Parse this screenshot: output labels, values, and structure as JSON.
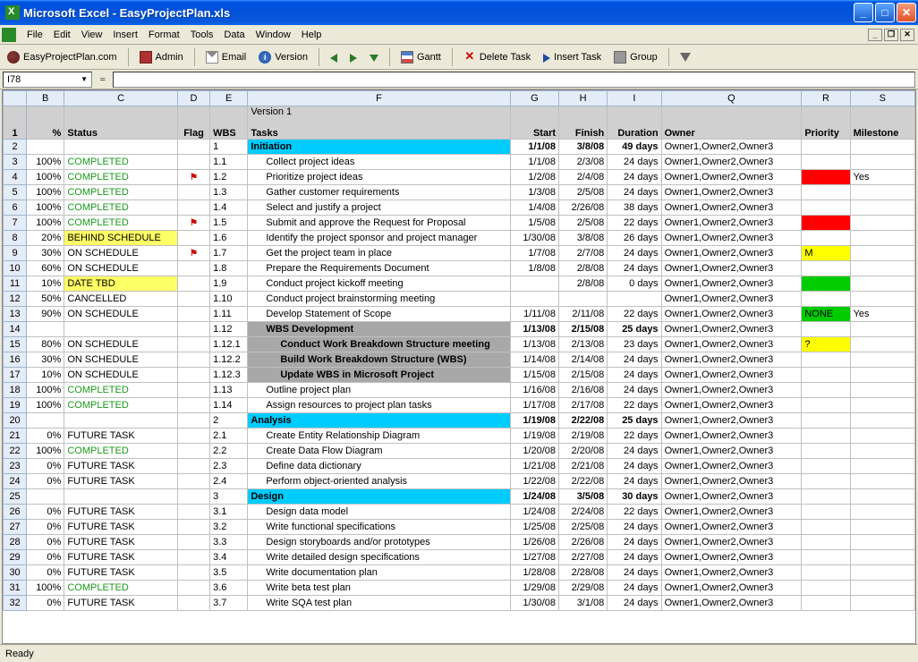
{
  "window": {
    "title": "Microsoft Excel - EasyProjectPlan.xls"
  },
  "menu": [
    "File",
    "Edit",
    "View",
    "Insert",
    "Format",
    "Tools",
    "Data",
    "Window",
    "Help"
  ],
  "toolbar": {
    "site": "EasyProjectPlan.com",
    "admin": "Admin",
    "email": "Email",
    "version": "Version",
    "gantt": "Gantt",
    "delete": "Delete Task",
    "insert": "Insert Task",
    "group": "Group"
  },
  "namebox": "I78",
  "formula": "=",
  "version_label": "Version 1",
  "columns": [
    "B",
    "C",
    "D",
    "E",
    "F",
    "G",
    "H",
    "I",
    "Q",
    "R",
    "S"
  ],
  "headers": {
    "B": "%",
    "C": "Status",
    "D": "Flag",
    "E": "WBS",
    "F": "Tasks",
    "G": "Start",
    "H": "Finish",
    "I": "Duration",
    "Q": "Owner",
    "R": "Priority",
    "S": "Milestone"
  },
  "rows": [
    {
      "r": 2,
      "pct": "",
      "status": "",
      "flag": "",
      "wbs": "1",
      "task": "Initiation",
      "taskbg": "cyan",
      "start": "1/1/08",
      "finish": "3/8/08",
      "dur": "49 days",
      "owner": "Owner1,Owner2,Owner3",
      "pr": "",
      "ms": "",
      "bold": true
    },
    {
      "r": 3,
      "pct": "100%",
      "status": "COMPLETED",
      "stc": "completed",
      "wbs": "1.1",
      "task": "Collect project ideas",
      "ind": 1,
      "start": "1/1/08",
      "finish": "2/3/08",
      "dur": "24 days",
      "owner": "Owner1,Owner2,Owner3"
    },
    {
      "r": 4,
      "pct": "100%",
      "status": "COMPLETED",
      "stc": "completed",
      "flag": "⚑",
      "wbs": "1.2",
      "task": "Prioritize project ideas",
      "ind": 1,
      "start": "1/2/08",
      "finish": "2/4/08",
      "dur": "24 days",
      "owner": "Owner1,Owner2,Owner3",
      "pr": "",
      "prc": "red",
      "ms": "Yes"
    },
    {
      "r": 5,
      "pct": "100%",
      "status": "COMPLETED",
      "stc": "completed",
      "wbs": "1.3",
      "task": "Gather customer requirements",
      "ind": 1,
      "start": "1/3/08",
      "finish": "2/5/08",
      "dur": "24 days",
      "owner": "Owner1,Owner2,Owner3"
    },
    {
      "r": 6,
      "pct": "100%",
      "status": "COMPLETED",
      "stc": "completed",
      "wbs": "1.4",
      "task": "Select and justify a project",
      "ind": 1,
      "start": "1/4/08",
      "finish": "2/26/08",
      "dur": "38 days",
      "owner": "Owner1,Owner2,Owner3"
    },
    {
      "r": 7,
      "pct": "100%",
      "status": "COMPLETED",
      "stc": "completed",
      "flag": "⚑",
      "wbs": "1.5",
      "task": "Submit and approve the Request for Proposal",
      "ind": 1,
      "start": "1/5/08",
      "finish": "2/5/08",
      "dur": "22 days",
      "owner": "Owner1,Owner2,Owner3",
      "pr": "",
      "prc": "red"
    },
    {
      "r": 8,
      "pct": "20%",
      "status": "BEHIND SCHEDULE",
      "stc": "behind",
      "wbs": "1.6",
      "task": "Identify the project sponsor and project manager",
      "ind": 1,
      "start": "1/30/08",
      "finish": "3/8/08",
      "dur": "26 days",
      "owner": "Owner1,Owner2,Owner3"
    },
    {
      "r": 9,
      "pct": "30%",
      "status": "ON SCHEDULE",
      "flag": "⚑",
      "wbs": "1.7",
      "task": "Get the project team in place",
      "ind": 1,
      "start": "1/7/08",
      "finish": "2/7/08",
      "dur": "24 days",
      "owner": "Owner1,Owner2,Owner3",
      "pr": "M",
      "prc": "yellow"
    },
    {
      "r": 10,
      "pct": "60%",
      "status": "ON SCHEDULE",
      "wbs": "1.8",
      "task": "Prepare the Requirements Document",
      "ind": 1,
      "start": "1/8/08",
      "finish": "2/8/08",
      "dur": "24 days",
      "owner": "Owner1,Owner2,Owner3"
    },
    {
      "r": 11,
      "pct": "10%",
      "status": "DATE TBD",
      "stc": "tbd",
      "wbs": "1.9",
      "task": "Conduct project kickoff meeting",
      "ind": 1,
      "start": "",
      "finish": "2/8/08",
      "dur": "0 days",
      "owner": "Owner1,Owner2,Owner3",
      "pr": "",
      "prc": "green"
    },
    {
      "r": 12,
      "pct": "50%",
      "status": "CANCELLED",
      "wbs": "1.10",
      "task": "Conduct project brainstorming meeting",
      "ind": 1,
      "start": "",
      "finish": "",
      "dur": "",
      "owner": "Owner1,Owner2,Owner3"
    },
    {
      "r": 13,
      "pct": "90%",
      "status": "ON SCHEDULE",
      "wbs": "1.11",
      "task": "Develop Statement of Scope",
      "ind": 1,
      "start": "1/11/08",
      "finish": "2/11/08",
      "dur": "22 days",
      "owner": "Owner1,Owner2,Owner3",
      "pr": "NONE",
      "prc": "green",
      "ms": "Yes"
    },
    {
      "r": 14,
      "pct": "",
      "status": "",
      "wbs": "1.12",
      "task": "WBS Development",
      "taskbg": "gray",
      "ind": 1,
      "start": "1/13/08",
      "finish": "2/15/08",
      "dur": "25 days",
      "owner": "Owner1,Owner2,Owner3",
      "bold": true
    },
    {
      "r": 15,
      "pct": "80%",
      "status": "ON SCHEDULE",
      "wbs": "1.12.1",
      "task": "Conduct Work Breakdown Structure meeting",
      "taskbg": "gray",
      "ind": 2,
      "start": "1/13/08",
      "finish": "2/13/08",
      "dur": "23 days",
      "owner": "Owner1,Owner2,Owner3",
      "pr": "?",
      "prc": "yellow"
    },
    {
      "r": 16,
      "pct": "30%",
      "status": "ON SCHEDULE",
      "wbs": "1.12.2",
      "task": "Build Work Breakdown Structure (WBS)",
      "taskbg": "gray",
      "ind": 2,
      "start": "1/14/08",
      "finish": "2/14/08",
      "dur": "24 days",
      "owner": "Owner1,Owner2,Owner3"
    },
    {
      "r": 17,
      "pct": "10%",
      "status": "ON SCHEDULE",
      "wbs": "1.12.3",
      "task": "Update WBS in Microsoft Project",
      "taskbg": "gray",
      "ind": 2,
      "start": "1/15/08",
      "finish": "2/15/08",
      "dur": "24 days",
      "owner": "Owner1,Owner2,Owner3"
    },
    {
      "r": 18,
      "pct": "100%",
      "status": "COMPLETED",
      "stc": "completed",
      "wbs": "1.13",
      "task": "Outline project plan",
      "ind": 1,
      "start": "1/16/08",
      "finish": "2/16/08",
      "dur": "24 days",
      "owner": "Owner1,Owner2,Owner3"
    },
    {
      "r": 19,
      "pct": "100%",
      "status": "COMPLETED",
      "stc": "completed",
      "wbs": "1.14",
      "task": "Assign resources to project plan tasks",
      "ind": 1,
      "start": "1/17/08",
      "finish": "2/17/08",
      "dur": "22 days",
      "owner": "Owner1,Owner2,Owner3"
    },
    {
      "r": 20,
      "pct": "",
      "status": "",
      "wbs": "2",
      "task": "Analysis",
      "taskbg": "cyan",
      "start": "1/19/08",
      "finish": "2/22/08",
      "dur": "25 days",
      "owner": "Owner1,Owner2,Owner3",
      "bold": true
    },
    {
      "r": 21,
      "pct": "0%",
      "status": "FUTURE TASK",
      "wbs": "2.1",
      "task": "Create Entity Relationship Diagram",
      "ind": 1,
      "start": "1/19/08",
      "finish": "2/19/08",
      "dur": "22 days",
      "owner": "Owner1,Owner2,Owner3"
    },
    {
      "r": 22,
      "pct": "100%",
      "status": "COMPLETED",
      "stc": "completed",
      "wbs": "2.2",
      "task": "Create Data Flow Diagram",
      "ind": 1,
      "start": "1/20/08",
      "finish": "2/20/08",
      "dur": "24 days",
      "owner": "Owner1,Owner2,Owner3"
    },
    {
      "r": 23,
      "pct": "0%",
      "status": "FUTURE TASK",
      "wbs": "2.3",
      "task": "Define data dictionary",
      "ind": 1,
      "start": "1/21/08",
      "finish": "2/21/08",
      "dur": "24 days",
      "owner": "Owner1,Owner2,Owner3"
    },
    {
      "r": 24,
      "pct": "0%",
      "status": "FUTURE TASK",
      "wbs": "2.4",
      "task": "Perform object-oriented analysis",
      "ind": 1,
      "start": "1/22/08",
      "finish": "2/22/08",
      "dur": "24 days",
      "owner": "Owner1,Owner2,Owner3"
    },
    {
      "r": 25,
      "pct": "",
      "status": "",
      "wbs": "3",
      "task": "Design",
      "taskbg": "cyan",
      "start": "1/24/08",
      "finish": "3/5/08",
      "dur": "30 days",
      "owner": "Owner1,Owner2,Owner3",
      "bold": true
    },
    {
      "r": 26,
      "pct": "0%",
      "status": "FUTURE TASK",
      "wbs": "3.1",
      "task": "Design data model",
      "ind": 1,
      "start": "1/24/08",
      "finish": "2/24/08",
      "dur": "22 days",
      "owner": "Owner1,Owner2,Owner3"
    },
    {
      "r": 27,
      "pct": "0%",
      "status": "FUTURE TASK",
      "wbs": "3.2",
      "task": "Write functional specifications",
      "ind": 1,
      "start": "1/25/08",
      "finish": "2/25/08",
      "dur": "24 days",
      "owner": "Owner1,Owner2,Owner3"
    },
    {
      "r": 28,
      "pct": "0%",
      "status": "FUTURE TASK",
      "wbs": "3.3",
      "task": "Design storyboards and/or prototypes",
      "ind": 1,
      "start": "1/26/08",
      "finish": "2/26/08",
      "dur": "24 days",
      "owner": "Owner1,Owner2,Owner3"
    },
    {
      "r": 29,
      "pct": "0%",
      "status": "FUTURE TASK",
      "wbs": "3.4",
      "task": "Write detailed design specifications",
      "ind": 1,
      "start": "1/27/08",
      "finish": "2/27/08",
      "dur": "24 days",
      "owner": "Owner1,Owner2,Owner3"
    },
    {
      "r": 30,
      "pct": "0%",
      "status": "FUTURE TASK",
      "wbs": "3.5",
      "task": "Write documentation plan",
      "ind": 1,
      "start": "1/28/08",
      "finish": "2/28/08",
      "dur": "24 days",
      "owner": "Owner1,Owner2,Owner3"
    },
    {
      "r": 31,
      "pct": "100%",
      "status": "COMPLETED",
      "stc": "completed",
      "wbs": "3.6",
      "task": "Write beta test plan",
      "ind": 1,
      "start": "1/29/08",
      "finish": "2/29/08",
      "dur": "24 days",
      "owner": "Owner1,Owner2,Owner3"
    },
    {
      "r": 32,
      "pct": "0%",
      "status": "FUTURE TASK",
      "wbs": "3.7",
      "task": "Write SQA test plan",
      "ind": 1,
      "start": "1/30/08",
      "finish": "3/1/08",
      "dur": "24 days",
      "owner": "Owner1,Owner2,Owner3"
    }
  ],
  "statusbar": "Ready"
}
